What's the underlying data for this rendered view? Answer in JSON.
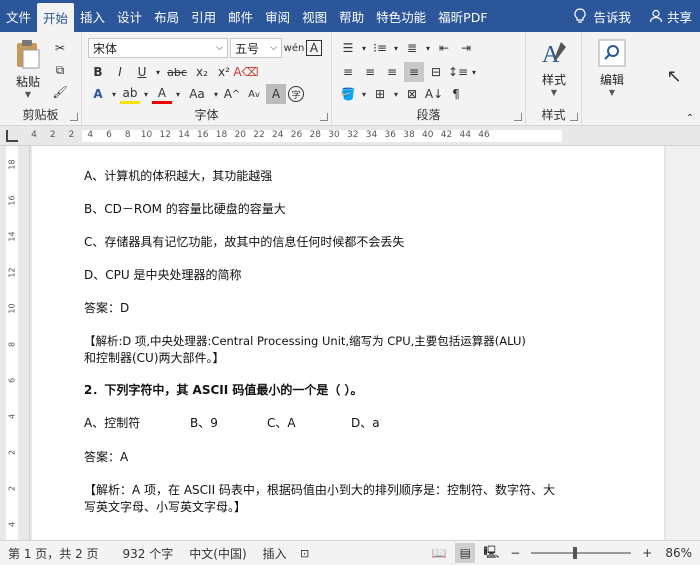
{
  "tabs": [
    "文件",
    "开始",
    "插入",
    "设计",
    "布局",
    "引用",
    "邮件",
    "审阅",
    "视图",
    "帮助",
    "特色功能",
    "福昕PDF"
  ],
  "active_tab_index": 1,
  "tell_me": "告诉我",
  "share": "共享",
  "ribbon": {
    "clipboard": {
      "paste_label": "粘贴",
      "group_label": "剪贴板"
    },
    "font": {
      "font_name": "宋体",
      "font_size": "五号",
      "group_label": "字体"
    },
    "paragraph": {
      "group_label": "段落"
    },
    "styles": {
      "label": "样式",
      "group_label": "样式"
    },
    "editing": {
      "label": "编辑"
    }
  },
  "ruler_numbers": [
    "4",
    "2",
    "2",
    "4",
    "6",
    "8",
    "10",
    "12",
    "14",
    "16",
    "18",
    "20",
    "22",
    "24",
    "26",
    "28",
    "30",
    "32",
    "34",
    "36",
    "38",
    "40",
    "42",
    "44",
    "46"
  ],
  "vruler_numbers": [
    "18",
    "16",
    "14",
    "12",
    "10",
    "8",
    "6",
    "4",
    "2",
    "2",
    "4"
  ],
  "document": {
    "lines": [
      "A、计算机的体积越大，其功能越强",
      "B、CD－ROM 的容量比硬盘的容量大",
      "C、存储器具有记忆功能，故其中的信息任何时候都不会丢失",
      "D、CPU 是中央处理器的简称",
      "答案：D",
      "【解析:D 项,中央处理器:Central Processing Unit,缩写为 CPU,主要包括运算器(ALU)",
      "和控制器(CU)两大部件。】",
      "2．下列字符中，其 ASCII 码值最小的一个是（  ）。",
      "答案：A",
      "【解析：A 项，在 ASCII 码表中，根据码值由小到大的排列顺序是：控制符、数字符、大",
      "写英文字母、小写英文字母。】"
    ],
    "options": [
      "A、控制符",
      "B、9",
      "C、A",
      "D、a"
    ]
  },
  "status": {
    "page": "第 1 页，共 2 页",
    "words": "932 个字",
    "lang": "中文(中国)",
    "mode": "插入",
    "zoom": "86%",
    "zoom_fraction": 0.43
  }
}
